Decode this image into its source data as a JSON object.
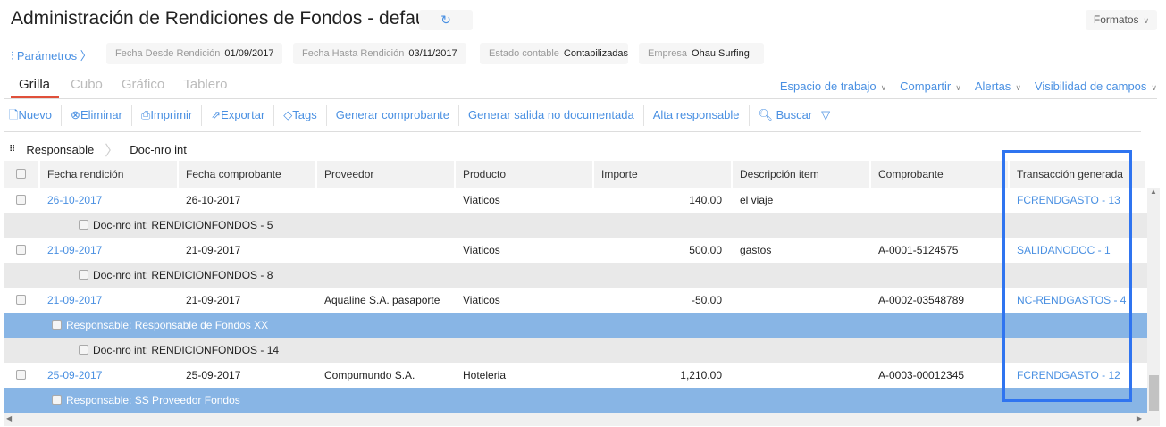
{
  "header": {
    "title": "Administración de Rendiciones de Fondos - default",
    "formatos": "Formatos"
  },
  "params": {
    "label": "Parámetros",
    "filters": [
      {
        "key": "Fecha Desde Rendición",
        "value": "01/09/2017"
      },
      {
        "key": "Fecha Hasta Rendición",
        "value": "03/11/2017"
      },
      {
        "key": "Estado contable",
        "value": "Contabilizadas"
      },
      {
        "key": "Empresa",
        "value": "Ohau Surfing"
      }
    ]
  },
  "tabs": [
    "Grilla",
    "Cubo",
    "Gráfico",
    "Tablero"
  ],
  "right_menu": [
    "Espacio de trabajo",
    "Compartir",
    "Alertas",
    "Visibilidad de campos"
  ],
  "toolbar": {
    "nuevo": "Nuevo",
    "eliminar": "Eliminar",
    "imprimir": "Imprimir",
    "exportar": "Exportar",
    "tags": "Tags",
    "generar": "Generar comprobante",
    "salida": "Generar salida no documentada",
    "alta": "Alta responsable",
    "buscar": "Buscar"
  },
  "grouping": [
    "Responsable",
    "Doc-nro int"
  ],
  "columns": [
    "Fecha rendición",
    "Fecha comprobante",
    "Proveedor",
    "Producto",
    "Importe",
    "Descripción item",
    "Comprobante",
    "Transacción generada"
  ],
  "rows": [
    {
      "type": "data",
      "cells": [
        "26-10-2017",
        "26-10-2017",
        "",
        "Viaticos",
        "140.00",
        "el viaje",
        "",
        "FCRENDGASTO - 13"
      ]
    },
    {
      "type": "doc",
      "label": "Doc-nro int: RENDICIONFONDOS - 5"
    },
    {
      "type": "data",
      "cells": [
        "21-09-2017",
        "21-09-2017",
        "",
        "Viaticos",
        "500.00",
        "gastos",
        "A-0001-5124575",
        "SALIDANODOC - 1"
      ]
    },
    {
      "type": "doc",
      "label": "Doc-nro int: RENDICIONFONDOS - 8"
    },
    {
      "type": "data",
      "cells": [
        "21-09-2017",
        "21-09-2017",
        "Aqualine S.A. pasaporte",
        "Viaticos",
        "-50.00",
        "",
        "A-0002-03548789",
        "NC-RENDGASTOS - 4"
      ]
    },
    {
      "type": "resp",
      "label": "Responsable: Responsable de Fondos XX"
    },
    {
      "type": "doc",
      "label": "Doc-nro int: RENDICIONFONDOS - 14"
    },
    {
      "type": "data",
      "cells": [
        "25-09-2017",
        "25-09-2017",
        "Compumundo S.A.",
        "Hoteleria",
        "1,210.00",
        "",
        "A-0003-00012345",
        "FCRENDGASTO - 12"
      ]
    },
    {
      "type": "resp",
      "label": "Responsable: SS Proveedor Fondos"
    }
  ],
  "colors": {
    "accent": "#4a90e2",
    "group_row": "#88b5e5",
    "highlight": "#2f74f0",
    "tab_underline": "#e0503a"
  }
}
